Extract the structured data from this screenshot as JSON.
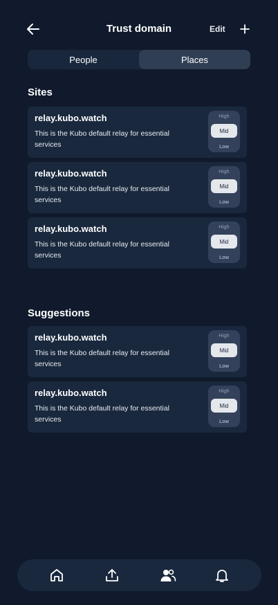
{
  "header": {
    "title": "Trust domain",
    "edit_label": "Edit"
  },
  "tabs": [
    {
      "label": "People",
      "active": false
    },
    {
      "label": "Places",
      "active": true
    }
  ],
  "sites": {
    "title": "Sites",
    "items": [
      {
        "name": "relay.kubo.watch",
        "description": "This is the Kubo default relay for essential services",
        "levels": {
          "high": "High",
          "mid": "Mid",
          "low": "Low"
        },
        "selected": "Mid"
      },
      {
        "name": "relay.kubo.watch",
        "description": "This is the Kubo default relay for essential services",
        "levels": {
          "high": "High",
          "mid": "Mid",
          "low": "Low"
        },
        "selected": "Mid"
      },
      {
        "name": "relay.kubo.watch",
        "description": "This is the Kubo default relay for essential services",
        "levels": {
          "high": "High",
          "mid": "Mid",
          "low": "Low"
        },
        "selected": "Mid"
      }
    ]
  },
  "suggestions": {
    "title": "Suggestions",
    "items": [
      {
        "name": "relay.kubo.watch",
        "description": "This is the Kubo default relay for essential services",
        "levels": {
          "high": "High",
          "mid": "Mid",
          "low": "Low"
        },
        "selected": "Mid"
      },
      {
        "name": "relay.kubo.watch",
        "description": "This is the Kubo default relay for essential services",
        "levels": {
          "high": "High",
          "mid": "Mid",
          "low": "Low"
        },
        "selected": "Mid"
      }
    ]
  },
  "bottom_nav": [
    {
      "icon": "home-icon"
    },
    {
      "icon": "upload-icon"
    },
    {
      "icon": "people-icon"
    },
    {
      "icon": "bell-icon"
    }
  ],
  "colors": {
    "background": "#101a2c",
    "card": "#19283d",
    "segment_active": "#303e54",
    "level_pill": "#33425a",
    "level_selected": "#e4e7ec"
  }
}
